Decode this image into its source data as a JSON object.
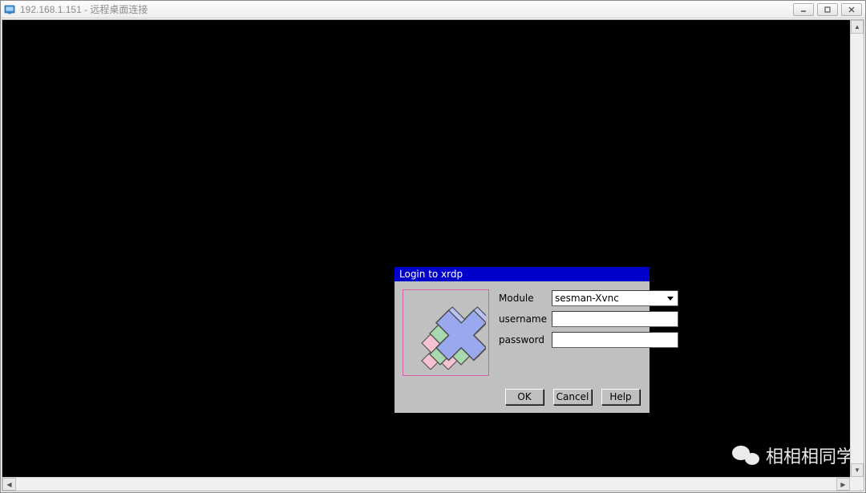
{
  "window": {
    "title_ip": "192.168.1.151",
    "title_suffix": " - 远程桌面连接"
  },
  "xrdp": {
    "title": "Login to xrdp",
    "labels": {
      "module": "Module",
      "username": "username",
      "password": "password"
    },
    "module_selected": "sesman-Xvnc",
    "username_value": "",
    "password_value": "",
    "buttons": {
      "ok": "OK",
      "cancel": "Cancel",
      "help": "Help"
    }
  },
  "watermark": {
    "text": "相相相同学"
  }
}
